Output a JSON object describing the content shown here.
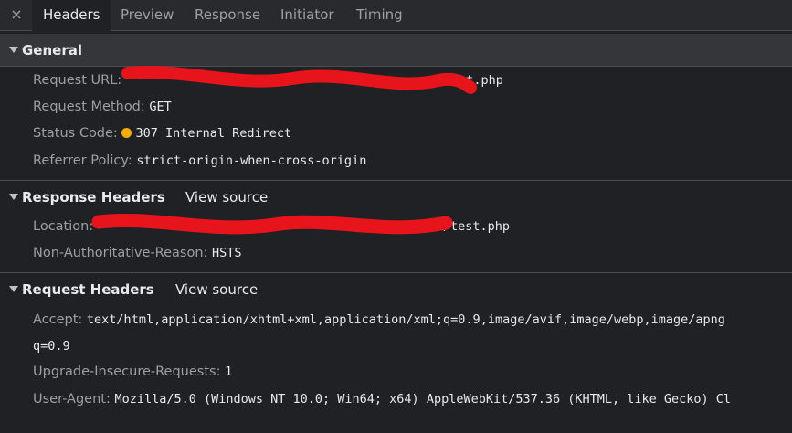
{
  "tabs": {
    "close_glyph": "×",
    "items": [
      "Headers",
      "Preview",
      "Response",
      "Initiator",
      "Timing"
    ],
    "active": "Headers"
  },
  "general": {
    "title": "General",
    "request_url_key": "Request URL:",
    "request_url_value_visible": "/test.php",
    "request_method_key": "Request Method:",
    "request_method_value": "GET",
    "status_code_key": "Status Code:",
    "status_code_value": "307 Internal Redirect",
    "status_color": "#f9ab00",
    "referrer_policy_key": "Referrer Policy:",
    "referrer_policy_value": "strict-origin-when-cross-origin"
  },
  "response_headers": {
    "title": "Response Headers",
    "view_source": "View source",
    "location_key": "Location:",
    "location_value_visible": "/test.php",
    "non_auth_key": "Non-Authoritative-Reason:",
    "non_auth_value": "HSTS"
  },
  "request_headers": {
    "title": "Request Headers",
    "view_source": "View source",
    "accept_key": "Accept:",
    "accept_value": "text/html,application/xhtml+xml,application/xml;q=0.9,image/avif,image/webp,image/apng",
    "accept_value_cont": "q=0.9",
    "upgrade_key": "Upgrade-Insecure-Requests:",
    "upgrade_value": "1",
    "user_agent_key": "User-Agent:",
    "user_agent_value": "Mozilla/5.0 (Windows NT 10.0; Win64; x64) AppleWebKit/537.36 (KHTML, like Gecko) Cl"
  },
  "colors": {
    "background": "#202124",
    "redaction": "#e8141b"
  }
}
